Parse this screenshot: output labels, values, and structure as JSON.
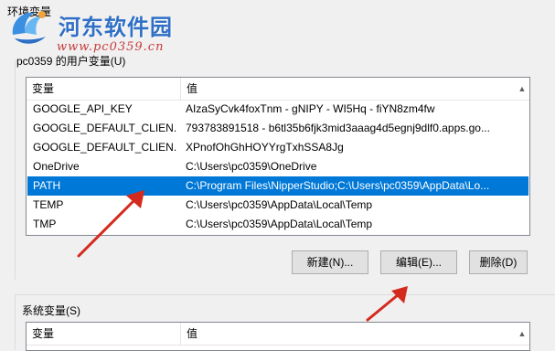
{
  "dialog": {
    "title": "环境变量"
  },
  "watermark": {
    "name": "河东软件园",
    "url": "www.pc0359.cn"
  },
  "user_vars": {
    "group_label": "pc0359 的用户变量(U)",
    "columns": {
      "variable": "变量",
      "value": "值"
    },
    "rows": [
      {
        "name": "GOOGLE_API_KEY",
        "value": "AIzaSyCvk4foxTnm - gNIPY - WI5Hq - fiYN8zm4fw"
      },
      {
        "name": "GOOGLE_DEFAULT_CLIEN...",
        "value": "793783891518 - b6tl35b6fjk3mid3aaag4d5egnj9dlf0.apps.go..."
      },
      {
        "name": "GOOGLE_DEFAULT_CLIEN...",
        "value": "XPnofOhGhHOYYrgTxhSSA8Jg"
      },
      {
        "name": "OneDrive",
        "value": "C:\\Users\\pc0359\\OneDrive"
      },
      {
        "name": "PATH",
        "value": "C:\\Program Files\\NipperStudio;C:\\Users\\pc0359\\AppData\\Lo..."
      },
      {
        "name": "TEMP",
        "value": "C:\\Users\\pc0359\\AppData\\Local\\Temp"
      },
      {
        "name": "TMP",
        "value": "C:\\Users\\pc0359\\AppData\\Local\\Temp"
      }
    ],
    "selected_index": 4,
    "buttons": {
      "new": "新建(N)...",
      "edit": "编辑(E)...",
      "delete": "删除(D)"
    }
  },
  "system_vars": {
    "group_label": "系统变量(S)",
    "columns": {
      "variable": "变量",
      "value": "值"
    }
  },
  "colors": {
    "selection": "#0078d7",
    "annotation_arrow": "#d42a1e"
  }
}
